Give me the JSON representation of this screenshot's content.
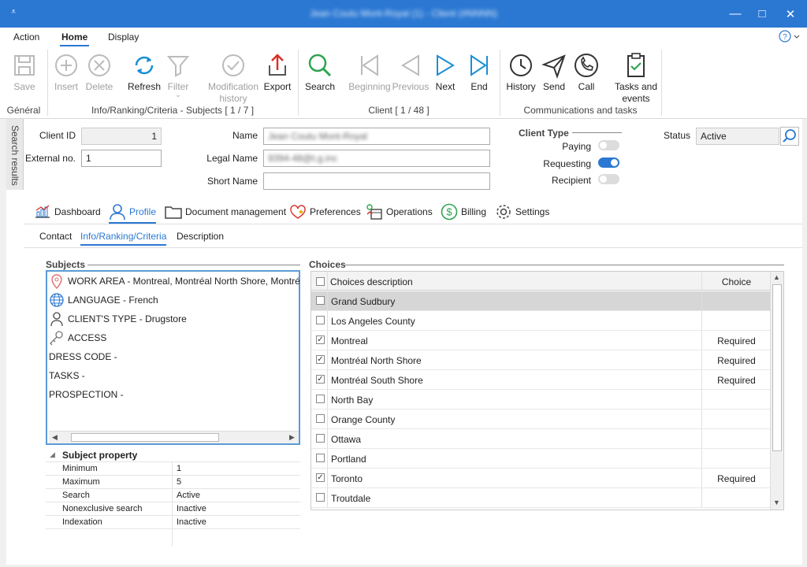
{
  "window": {
    "title": "Jean Coutu Mont-Royal (1) - Client (#NNNN)",
    "qat_icon": "dropdown-arrow-icon",
    "minimize_icon": "minimize-icon",
    "maximize_icon": "maximize-icon",
    "close_icon": "close-icon"
  },
  "menu": {
    "action": "Action",
    "home": "Home",
    "display": "Display",
    "help_icon": "help-icon"
  },
  "ribbon": {
    "save": "Save",
    "insert": "Insert",
    "delete": "Delete",
    "refresh": "Refresh",
    "filter": "Filter",
    "modification": "Modification",
    "history_word": "history",
    "export": "Export",
    "search": "Search",
    "beginning": "Beginning",
    "previous": "Previous",
    "next": "Next",
    "end": "End",
    "history": "History",
    "send": "Send",
    "call": "Call",
    "tasks": "Tasks and",
    "events": "events",
    "group_general": "Général",
    "group_info": "Info/Ranking/Criteria - Subjects [ 1 / 7 ]",
    "group_client": "Client [ 1 / 48 ]",
    "group_comm": "Communications and tasks"
  },
  "sidebar": {
    "label": "Search results"
  },
  "form": {
    "client_id_label": "Client ID",
    "client_id": "1",
    "external_label": "External no.",
    "external": "1",
    "name_label": "Name",
    "name": "Jean Coutu Mont-Royal",
    "legal_label": "Legal Name",
    "legal": "9394-48@t.g.inc",
    "short_label": "Short Name",
    "short": "",
    "client_type_label": "Client Type",
    "paying": "Paying",
    "requesting": "Requesting",
    "recipient": "Recipient",
    "paying_on": false,
    "requesting_on": true,
    "recipient_on": false,
    "status_label": "Status",
    "status": "Active"
  },
  "tabs": {
    "dashboard": "Dashboard",
    "profile": "Profile",
    "docs": "Document management",
    "preferences": "Preferences",
    "operations": "Operations",
    "billing": "Billing",
    "settings": "Settings"
  },
  "subtabs": {
    "contact": "Contact",
    "info": "Info/Ranking/Criteria",
    "description": "Description"
  },
  "subjects": {
    "header": "Subjects",
    "items": [
      {
        "label": "WORK AREA - Montreal, Montréal North Shore, Montréal South Shore, Toronto",
        "icon": "map-pin-icon"
      },
      {
        "label": "LANGUAGE - French",
        "icon": "globe-icon"
      },
      {
        "label": "CLIENT'S TYPE - Drugstore",
        "icon": "person-icon"
      },
      {
        "label": "ACCESS",
        "icon": "key-icon"
      },
      {
        "label": "DRESS CODE -",
        "icon": ""
      },
      {
        "label": "TASKS -",
        "icon": ""
      },
      {
        "label": "PROSPECTION -",
        "icon": ""
      }
    ]
  },
  "property": {
    "header": "Subject property",
    "rows": [
      {
        "k": "Minimum",
        "v": "1"
      },
      {
        "k": "Maximum",
        "v": "5"
      },
      {
        "k": "Search",
        "v": "Active"
      },
      {
        "k": "Nonexclusive search",
        "v": "Inactive"
      },
      {
        "k": "Indexation",
        "v": "Inactive"
      }
    ]
  },
  "choices": {
    "header": "Choices",
    "col_desc": "Choices description",
    "col_choice": "Choice",
    "rows": [
      {
        "d": "Grand Sudbury",
        "c": "",
        "checked": false
      },
      {
        "d": "Los Angeles County",
        "c": "",
        "checked": false
      },
      {
        "d": "Montreal",
        "c": "Required",
        "checked": true
      },
      {
        "d": "Montréal North Shore",
        "c": "Required",
        "checked": true
      },
      {
        "d": "Montréal South Shore",
        "c": "Required",
        "checked": true
      },
      {
        "d": "North Bay",
        "c": "",
        "checked": false
      },
      {
        "d": "Orange County",
        "c": "",
        "checked": false
      },
      {
        "d": "Ottawa",
        "c": "",
        "checked": false
      },
      {
        "d": "Portland",
        "c": "",
        "checked": false
      },
      {
        "d": "Toronto",
        "c": "Required",
        "checked": true
      },
      {
        "d": "Troutdale",
        "c": "",
        "checked": false
      }
    ]
  },
  "colors": {
    "accent": "#2b78d3",
    "refresh": "#1a8fd6",
    "search": "#2ea44f",
    "export_arrow": "#d9302c"
  }
}
